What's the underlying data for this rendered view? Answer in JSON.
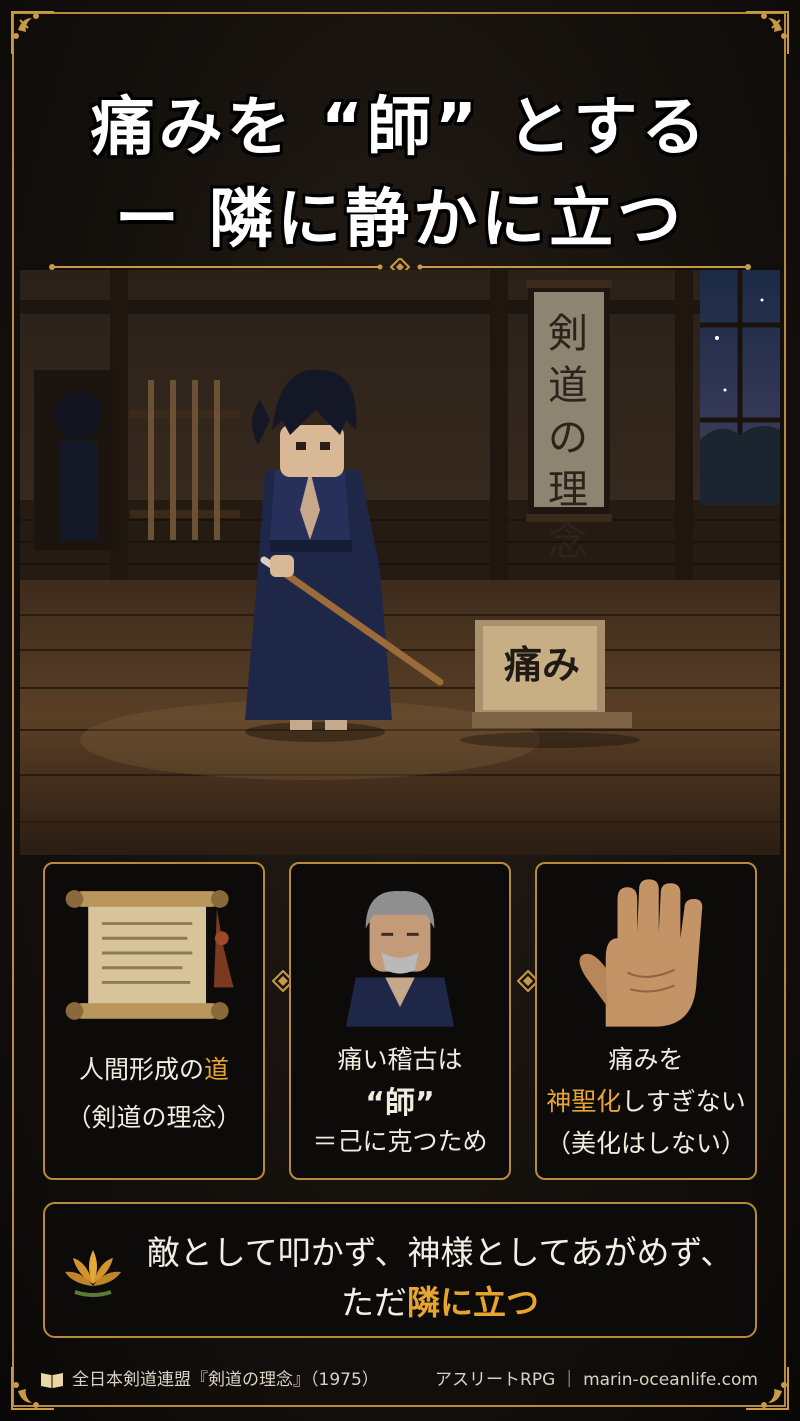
{
  "title": {
    "line1": "痛みを “師” とする",
    "line2": "ー 隣に静かに立つ"
  },
  "scene": {
    "scroll_text": "剣道の理念",
    "block_text": "痛み"
  },
  "cards": [
    {
      "line1": "人間形成の",
      "line1_highlight": "道",
      "line2": "（剣道の理念）"
    },
    {
      "line1": "痛い稽古は",
      "line2_highlight": "“師”",
      "line3_highlight": "＝己に克つため"
    },
    {
      "line1": "痛みを",
      "line2_highlight": "神聖化",
      "line2_rest": "しすぎない",
      "line3": "（美化はしない）"
    }
  ],
  "banner": {
    "line1": "敵として叩かず、神様としてあがめず、",
    "line2_prefix": "ただ",
    "line2_highlight": "隣に立つ"
  },
  "footer": {
    "left": "全日本剣道連盟『剣道の理念』（1975）",
    "right": "アスリートRPG ｜ marin-oceanlife.com"
  },
  "colors": {
    "gold": "#e7a52f",
    "frame": "#b88a3a",
    "text": "#f1ebe0"
  }
}
